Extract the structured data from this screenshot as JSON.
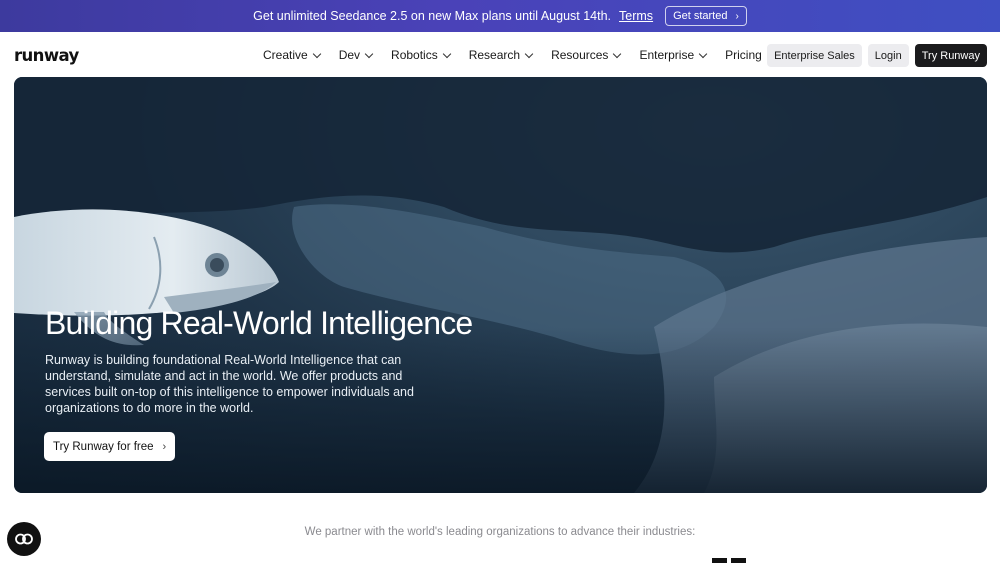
{
  "announcement": {
    "text": "Get unlimited Seedance 2.5 on new Max plans until August 14th.",
    "terms_label": "Terms",
    "cta_label": "Get started"
  },
  "nav": {
    "logo": "runway",
    "menu": [
      {
        "label": "Creative",
        "has_dropdown": true
      },
      {
        "label": "Dev",
        "has_dropdown": true
      },
      {
        "label": "Robotics",
        "has_dropdown": true
      },
      {
        "label": "Research",
        "has_dropdown": true
      },
      {
        "label": "Resources",
        "has_dropdown": true
      },
      {
        "label": "Enterprise",
        "has_dropdown": true
      },
      {
        "label": "Pricing",
        "has_dropdown": false
      }
    ],
    "enterprise_sales_label": "Enterprise Sales",
    "login_label": "Login",
    "try_label": "Try Runway"
  },
  "hero": {
    "title": "Building Real-World Intelligence",
    "description": "Runway is building foundational Real-World Intelligence that can understand, simulate and act in the world. We offer products and services built on-top of this intelligence to empower individuals and organizations to do more in the world.",
    "cta_label": "Try Runway for free"
  },
  "partners": {
    "text": "We partner with the world's leading organizations to advance their industries:"
  },
  "colors": {
    "announcement_bg": "#4a42b8",
    "hero_bg": "#1e3347",
    "primary_button": "#1b1b1d"
  },
  "icons": {
    "chat_bubble": "chat-bubble-icon",
    "chevron": "chevron-right-icon",
    "dropdown": "chevron-down-icon"
  }
}
